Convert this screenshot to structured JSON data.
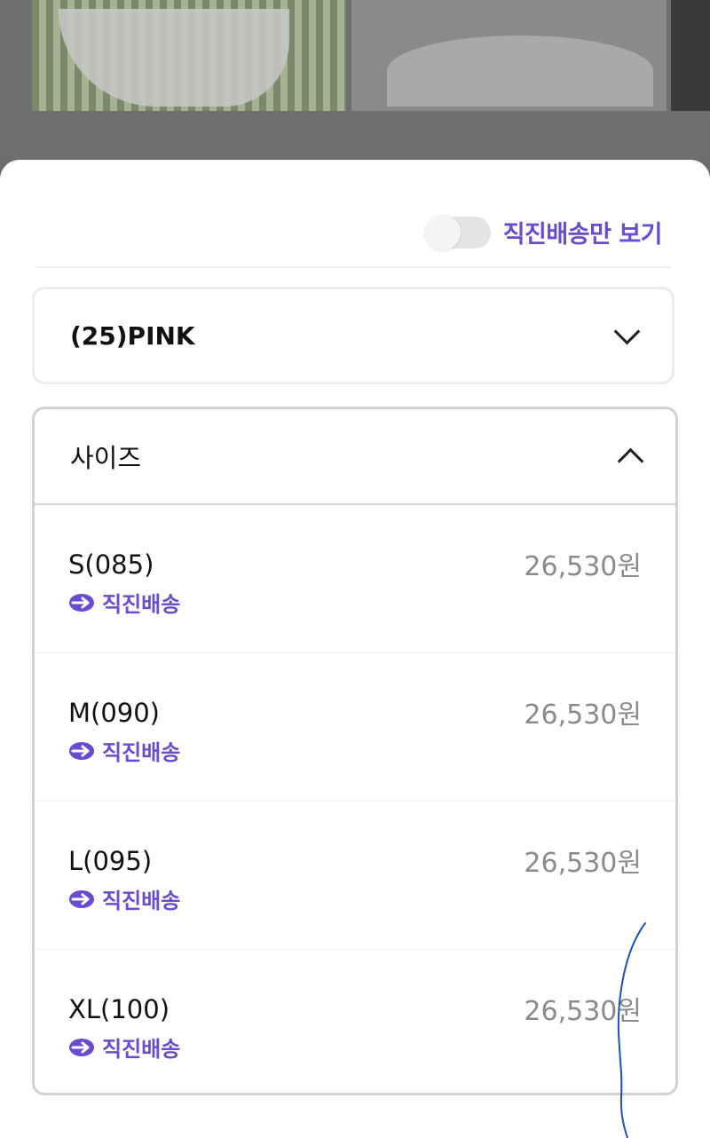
{
  "filter": {
    "toggle_label": "직진배송만 보기",
    "toggle_on": false
  },
  "color_option": {
    "selected": "(25)PINK"
  },
  "size_option": {
    "title": "사이즈",
    "items": [
      {
        "name": "S(085)",
        "price": "26,530원",
        "badge": "직진배송"
      },
      {
        "name": "M(090)",
        "price": "26,530원",
        "badge": "직진배송"
      },
      {
        "name": "L(095)",
        "price": "26,530원",
        "badge": "직진배송"
      },
      {
        "name": "XL(100)",
        "price": "26,530원",
        "badge": "직진배송"
      }
    ]
  },
  "colors": {
    "accent": "#6a4bd1",
    "price": "#8b8b8b",
    "pen": "#1f4fb8"
  },
  "icons": {
    "badge_icon": "arrow-circle-icon",
    "collapsed": "chevron-down-icon",
    "expanded": "chevron-up-icon"
  }
}
